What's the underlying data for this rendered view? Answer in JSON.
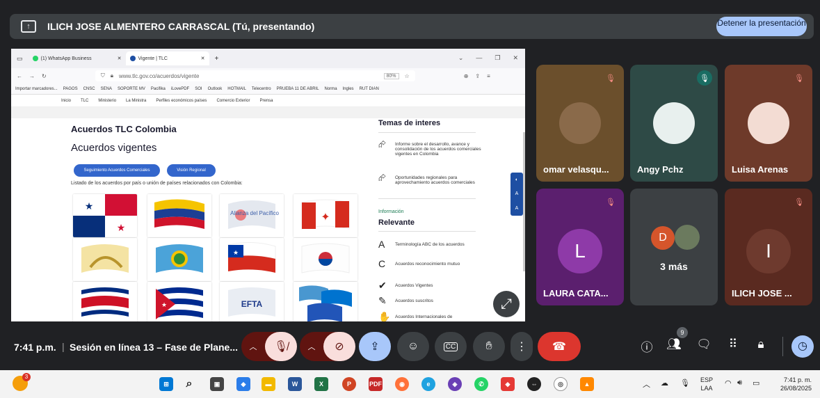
{
  "top_bar": {
    "presenter_title": "ILICH JOSE ALMENTERO CARRASCAL (Tú, presentando)",
    "stop_button": "Detener la presentación"
  },
  "browser": {
    "tabs": [
      {
        "label": "(1) WhatsApp Business"
      },
      {
        "label": "Vigente | TLC"
      }
    ],
    "url": "www.tlc.gov.co/acuerdos/vigente",
    "zoom": "80%",
    "bookmarks": [
      "Importar marcadores...",
      "PAGOS",
      "CNSC",
      "SENA",
      "SOPORTE MV",
      "Pacifika",
      "iLovePDF",
      "SOI",
      "Outlook",
      "HOTMAIL",
      "Telecentro",
      "PRUEBA 11 DE ABRIL",
      "Norma",
      "Ingles",
      "RUT DIAN"
    ],
    "site_nav": [
      "Inicio",
      "TLC",
      "Ministerio",
      "La Ministra",
      "Perfiles económicos países",
      "Comercio Exterior",
      "Prensa"
    ]
  },
  "page": {
    "section_title": "Acuerdos TLC Colombia",
    "heading": "Acuerdos vigentes",
    "btn_seguimiento": "Seguimiento Acuerdos Comerciales",
    "btn_vision": "Visión Regional",
    "list_description": "Listado de los acuerdos por país o unión de países relacionados con Colombia:",
    "flag_labels": {
      "pacifico": "Alianza del Pacífico",
      "efta": "EFTA"
    },
    "temas_title": "Temas de interes",
    "temas": [
      {
        "text": "Informe sobre el desarrollo, avance y consolidación de los acuerdos comerciales vigentes en Colombia"
      },
      {
        "text": "Oportunidades regionales para aprovechamiento acuerdos comerciales"
      }
    ],
    "info_label": "Información",
    "relevante_title": "Relevante",
    "relevante": [
      {
        "text": "Terminología ABC de los acuerdos"
      },
      {
        "text": "Acuerdos reconocimiento mutuo"
      },
      {
        "text": "Acuerdos Vigentes"
      },
      {
        "text": "Acuerdos suscritos"
      },
      {
        "text": "Acuerdos Internacionales de"
      }
    ]
  },
  "participants": [
    {
      "name": "omar velasqu...",
      "bg": "#6b4f2c",
      "avatar_type": "photo"
    },
    {
      "name": "Angy Pchz",
      "bg": "#2e4a46",
      "avatar_type": "photo"
    },
    {
      "name": "Luisa Arenas",
      "bg": "#6e3a2a",
      "avatar_type": "photo"
    },
    {
      "name": "LAURA CATA...",
      "bg": "#5b1f6e",
      "avatar_type": "letter",
      "letter": "L",
      "avatar_color": "#8e3aa8"
    },
    {
      "name": "",
      "bg": "#3c4043",
      "avatar_type": "group",
      "letter": "D",
      "more": "3 más"
    },
    {
      "name": "ILICH JOSE ...",
      "bg": "#5a2a20",
      "avatar_type": "letter",
      "letter": "I",
      "avatar_color": "#6e3a2e"
    }
  ],
  "bottom_bar": {
    "time": "7:41 p.m.",
    "meeting_name": "Sesión en línea 13 – Fase de Plane...",
    "people_badge": "9"
  },
  "taskbar": {
    "lang_line1": "ESP",
    "lang_line2": "LAA",
    "time": "7:41 p. m.",
    "date": "26/08/2025",
    "start_badge": "3"
  }
}
